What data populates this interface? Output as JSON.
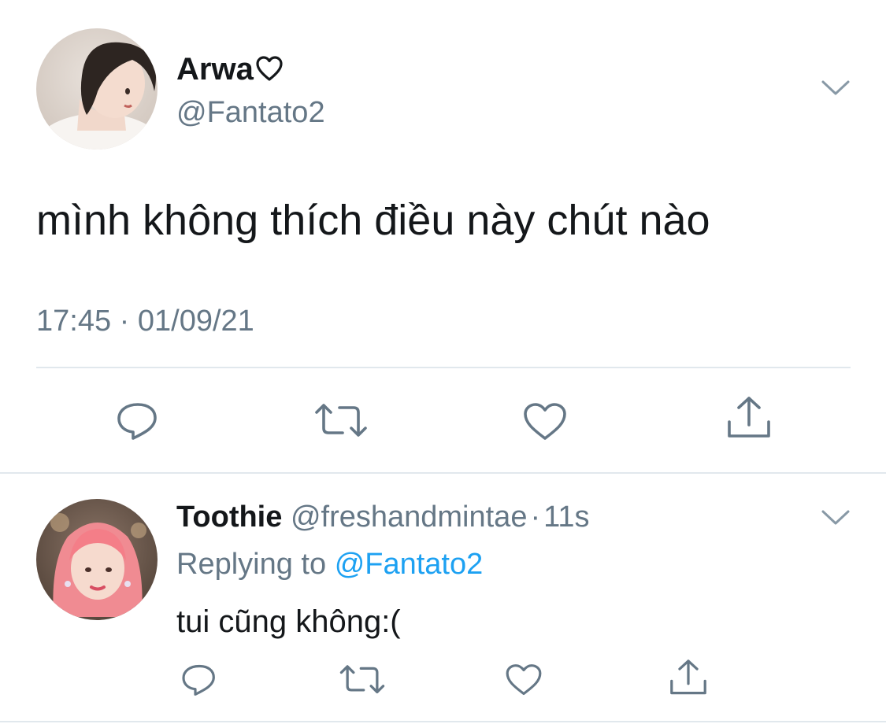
{
  "main_tweet": {
    "display_name": "Arwa",
    "handle": "@Fantato2",
    "text": "mình không thích điều này chút nào",
    "timestamp": "17:45 · 01/09/21",
    "name_emoji": "white-heart-icon",
    "actions": [
      "reply-icon",
      "retweet-icon",
      "like-icon",
      "share-icon"
    ]
  },
  "reply_tweet": {
    "display_name": "Toothie",
    "handle": "@freshandmintae",
    "separator": "·",
    "time_ago": "11s",
    "replying_prefix": "Replying to",
    "replying_to": "@Fantato2",
    "text": "tui cũng không:(",
    "actions": [
      "reply-icon",
      "retweet-icon",
      "like-icon",
      "share-icon"
    ]
  },
  "colors": {
    "text": "#14171a",
    "muted": "#657786",
    "link": "#1da1f2",
    "divider": "#e1e8ed"
  }
}
